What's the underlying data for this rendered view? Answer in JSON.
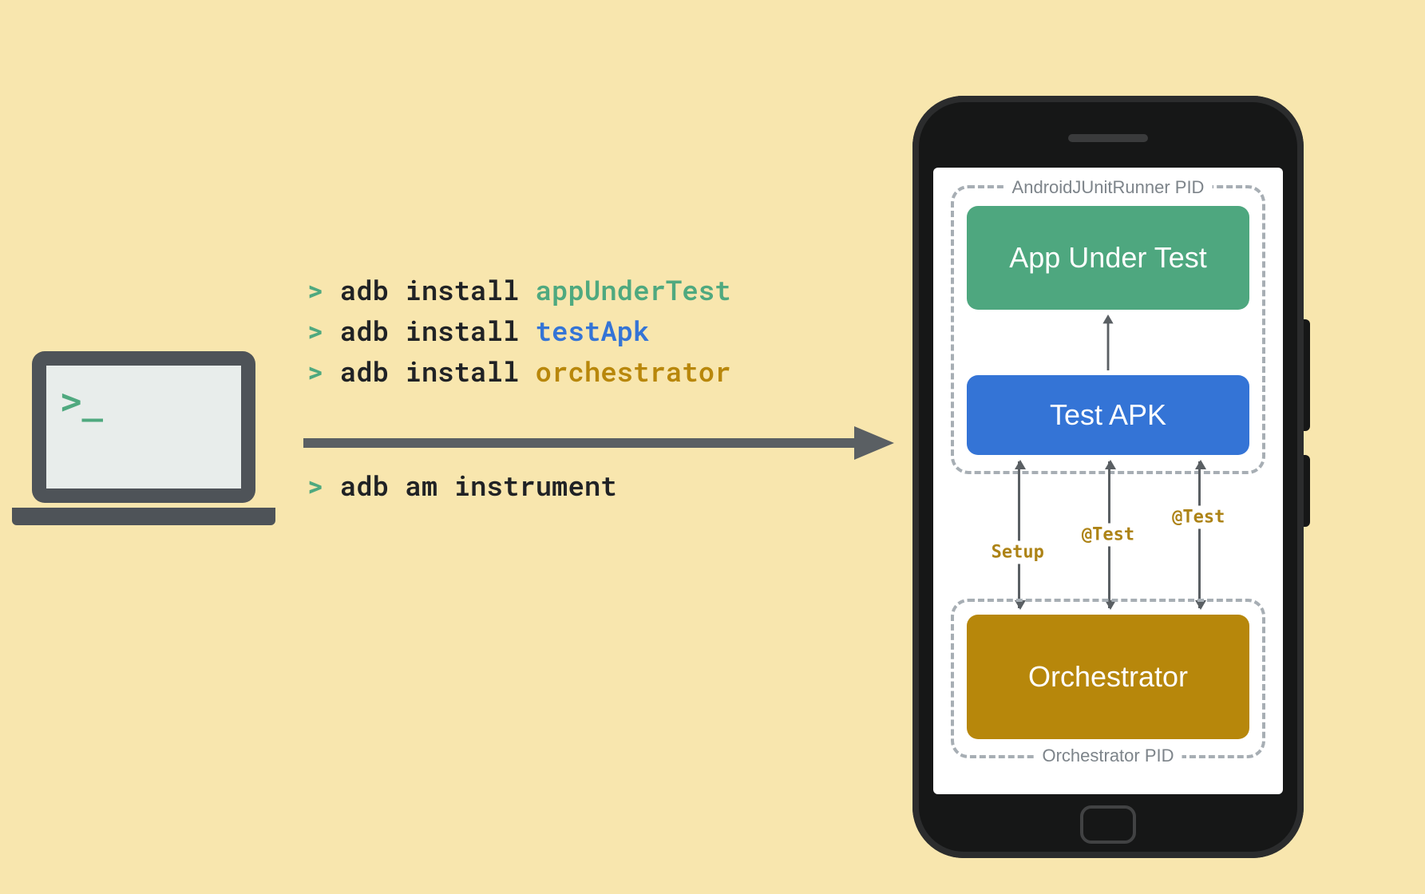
{
  "laptop": {
    "prompt_glyph": ">_"
  },
  "commands": {
    "line1": {
      "prompt": ">",
      "cmd": "adb install",
      "arg": "appUnderTest",
      "arg_class": "arg-green"
    },
    "line2": {
      "prompt": ">",
      "cmd": "adb install",
      "arg": "testApk",
      "arg_class": "arg-blue"
    },
    "line3": {
      "prompt": ">",
      "cmd": "adb install",
      "arg": "orchestrator",
      "arg_class": "arg-gold"
    },
    "line4": {
      "prompt": ">",
      "cmd": "adb am instrument"
    }
  },
  "phone": {
    "pid_top_label": "AndroidJUnitRunner PID",
    "pid_bottom_label": "Orchestrator PID",
    "box_app": "App Under Test",
    "box_testapk": "Test APK",
    "box_orch": "Orchestrator",
    "conn_labels": {
      "setup": "Setup",
      "test1": "@Test",
      "test2": "@Test"
    }
  },
  "colors": {
    "bg": "#f8e6ae",
    "green": "#4fa97f",
    "blue": "#3474d6",
    "gold": "#b8870b",
    "dark": "#4e5358"
  }
}
